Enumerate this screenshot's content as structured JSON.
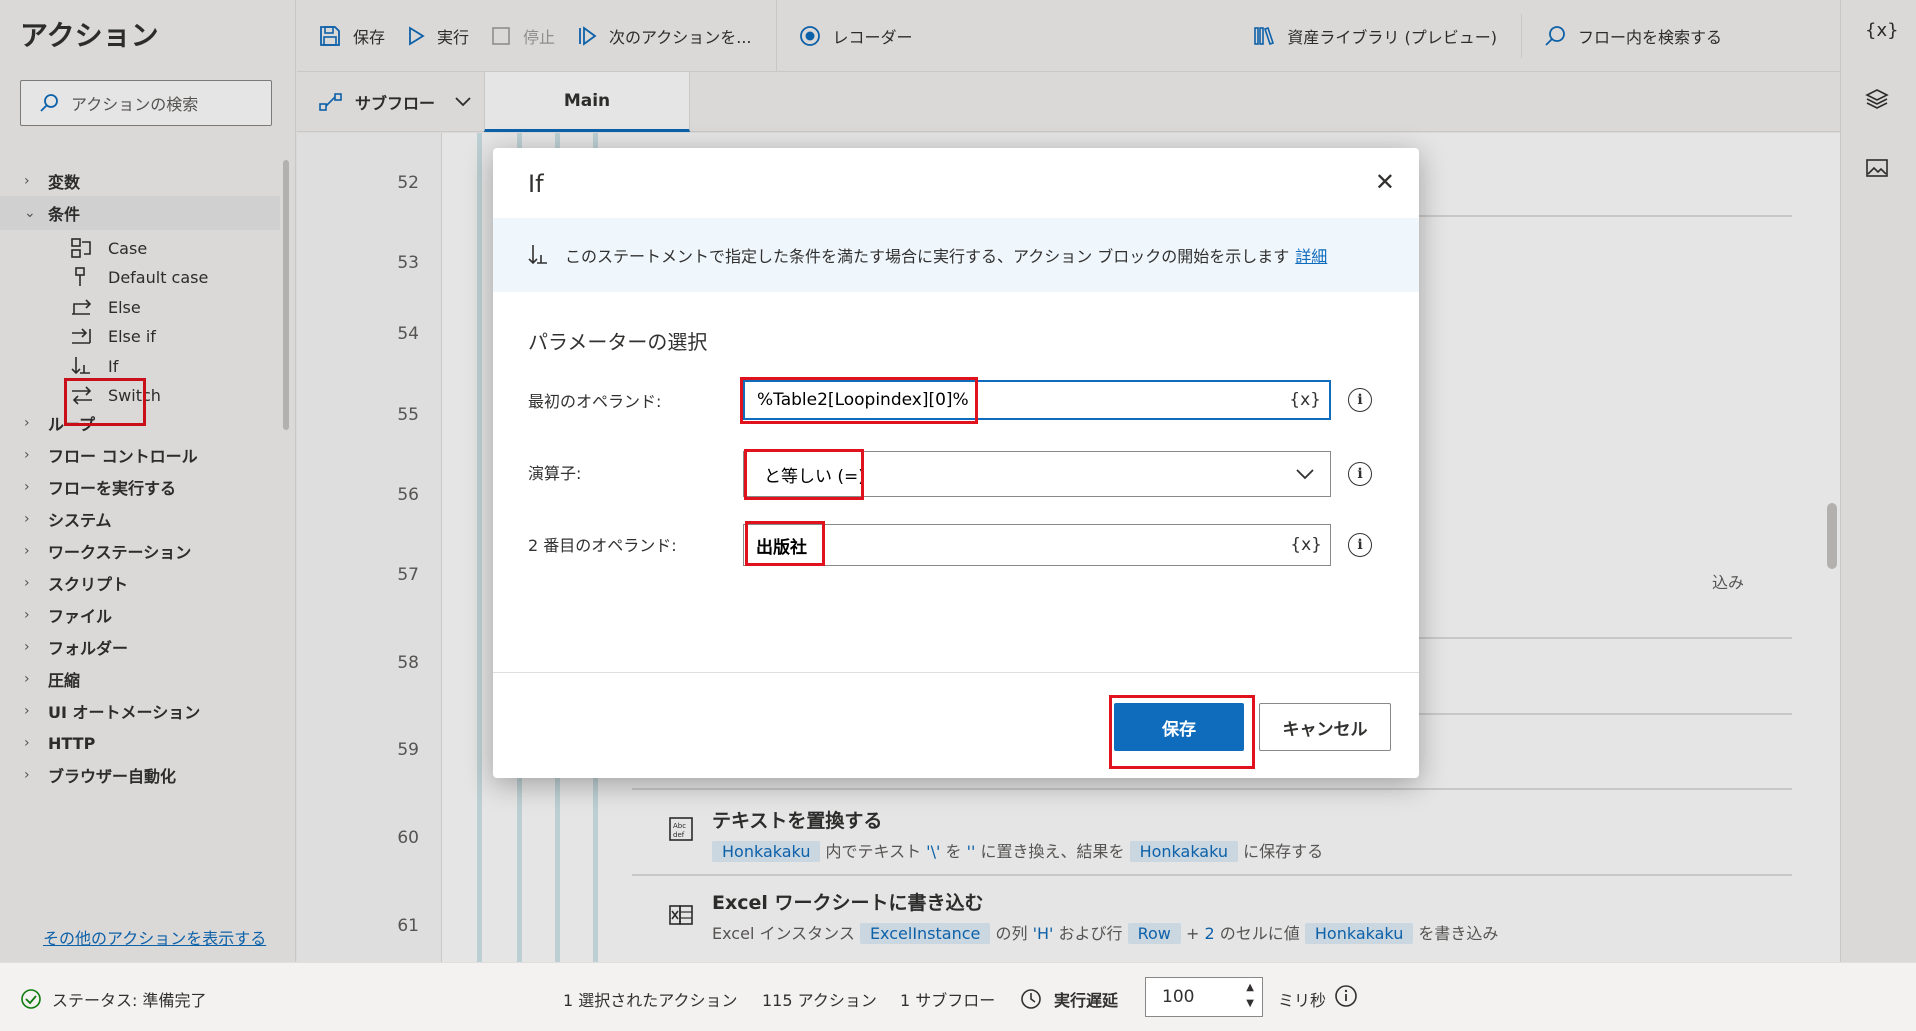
{
  "left_pane": {
    "title": "アクション",
    "search_placeholder": "アクションの検索",
    "categories": [
      {
        "label": "変数"
      },
      {
        "label": "条件"
      },
      {
        "label": "ループ"
      },
      {
        "label": "フロー コントロール"
      },
      {
        "label": "フローを実行する"
      },
      {
        "label": "システム"
      },
      {
        "label": "ワークステーション"
      },
      {
        "label": "スクリプト"
      },
      {
        "label": "ファイル"
      },
      {
        "label": "フォルダー"
      },
      {
        "label": "圧縮"
      },
      {
        "label": "UI オートメーション"
      },
      {
        "label": "HTTP"
      },
      {
        "label": "ブラウザー自動化"
      }
    ],
    "condition_items": [
      {
        "label": "Case",
        "icon": "case-icon"
      },
      {
        "label": "Default case",
        "icon": "default-case-icon"
      },
      {
        "label": "Else",
        "icon": "else-icon"
      },
      {
        "label": "Else if",
        "icon": "else-if-icon"
      },
      {
        "label": "If",
        "icon": "if-icon"
      },
      {
        "label": "Switch",
        "icon": "switch-icon"
      }
    ],
    "more_link": "その他のアクションを表示する"
  },
  "toolbar": {
    "save": "保存",
    "run": "実行",
    "stop": "停止",
    "next_action": "次のアクションを...",
    "recorder": "レコーダー",
    "asset_library": "資産ライブラリ (プレビュー)",
    "search_flow": "フロー内を検索する"
  },
  "tabs": {
    "subflow": "サブフロー",
    "main": "Main"
  },
  "rail": {
    "variables": "{x}"
  },
  "editor": {
    "line_numbers": [
      "52",
      "53",
      "54",
      "55",
      "56",
      "57",
      "58",
      "59",
      "60",
      "61"
    ],
    "partial_text_57": "込み",
    "step60": {
      "title": "テキストを置換する",
      "var1": "Honkakaku",
      "t1": "内でテキスト",
      "q1": "'\\'",
      "t2": "を",
      "q2": "''",
      "t3": "に置き換え、結果を",
      "var2": "Honkakaku",
      "t4": "に保存する"
    },
    "step61": {
      "title": "Excel ワークシートに書き込む",
      "t1": "Excel インスタンス",
      "var1": "ExcelInstance",
      "t2": "の列",
      "q1": "'H'",
      "t3": "および行",
      "var2": "Row",
      "t4": "+",
      "q2": "2",
      "t5": "のセルに値",
      "var3": "Honkakaku",
      "t6": "を書き込み"
    }
  },
  "dialog": {
    "title": "If",
    "info_text": "このステートメントで指定した条件を満たす場合に実行する、アクション ブロックの開始を示します",
    "info_link": "詳細",
    "section": "パラメーターの選択",
    "first_operand_label": "最初のオペランド:",
    "first_operand_value": "%Table2[Loopindex][0]%",
    "operator_label": "演算子:",
    "operator_value": "と等しい (=)",
    "second_operand_label": "2 番目のオペランド:",
    "second_operand_value": "出版社",
    "var_button": "{x}",
    "save": "保存",
    "cancel": "キャンセル"
  },
  "status_bar": {
    "status": "ステータス: 準備完了",
    "selected": "1 選択されたアクション",
    "actions": "115 アクション",
    "subflows": "1 サブフロー",
    "delay_label": "実行遅延",
    "delay_value": "100",
    "delay_unit": "ミリ秒"
  }
}
